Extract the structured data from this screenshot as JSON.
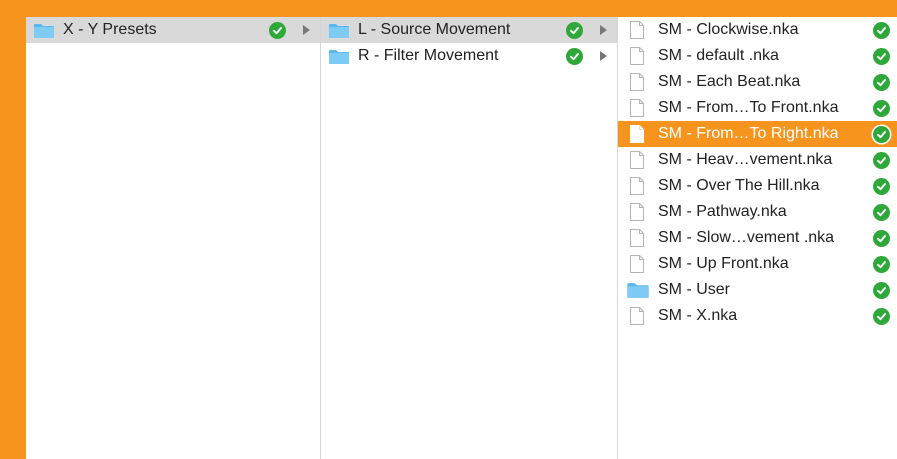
{
  "column1": {
    "items": [
      {
        "label": "X - Y Presets",
        "type": "folder",
        "selected": true
      }
    ]
  },
  "column2": {
    "items": [
      {
        "label": "L - Source Movement",
        "type": "folder",
        "selected": true
      },
      {
        "label": "R - Filter Movement",
        "type": "folder",
        "selected": false
      }
    ]
  },
  "column3": {
    "items": [
      {
        "label": "SM - Clockwise.nka",
        "type": "file"
      },
      {
        "label": "SM - default .nka",
        "type": "file"
      },
      {
        "label": "SM - Each Beat.nka",
        "type": "file"
      },
      {
        "label": "SM - From…To Front.nka",
        "type": "file"
      },
      {
        "label": "SM - From…To Right.nka",
        "type": "file",
        "selected": true
      },
      {
        "label": "SM - Heav…vement.nka",
        "type": "file"
      },
      {
        "label": "SM - Over The Hill.nka",
        "type": "file"
      },
      {
        "label": "SM - Pathway.nka",
        "type": "file"
      },
      {
        "label": "SM - Slow…vement .nka",
        "type": "file"
      },
      {
        "label": "SM - Up Front.nka",
        "type": "file"
      },
      {
        "label": "SM - User",
        "type": "folder"
      },
      {
        "label": "SM - X.nka",
        "type": "file"
      }
    ]
  },
  "icons": {
    "folder": "folder-icon",
    "file": "file-icon",
    "sync_status": "green-checkmark-icon",
    "disclosure": "chevron-right-icon"
  },
  "colors": {
    "frame": "#F7941D",
    "selection_active": "#F7941D",
    "selection_inactive": "#D9D9D9",
    "folder": "#5BB8EE",
    "check": "#2FA83A"
  }
}
